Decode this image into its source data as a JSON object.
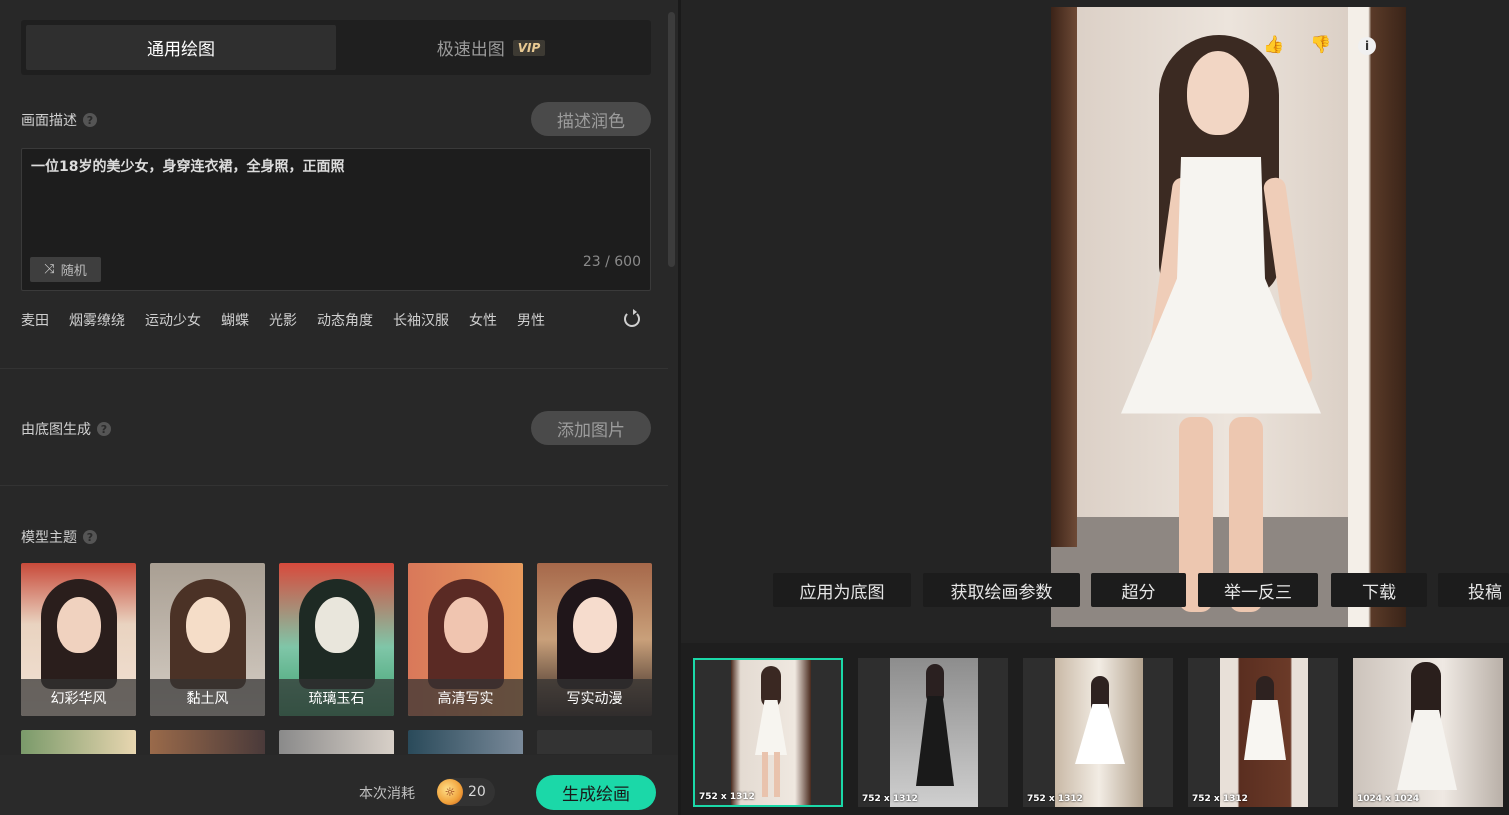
{
  "mode_tabs": [
    {
      "label": "通用绘图",
      "active": true
    },
    {
      "label": "极速出图",
      "active": false,
      "badge": "VIP"
    }
  ],
  "prompt_section": {
    "label": "画面描述",
    "enhance_button": "描述润色",
    "text": "一位18岁的美少女，身穿连衣裙，全身照，正面照",
    "random_button": "随机",
    "char_count": "23 / 600"
  },
  "tags": [
    "麦田",
    "烟雾缭绕",
    "运动少女",
    "蝴蝶",
    "光影",
    "动态角度",
    "长袖汉服",
    "女性",
    "男性"
  ],
  "base_image_section": {
    "label": "由底图生成",
    "add_button": "添加图片"
  },
  "model_section": {
    "label": "模型主题",
    "models": [
      {
        "name": "幻彩华风",
        "selected": false
      },
      {
        "name": "黏土风",
        "selected": false
      },
      {
        "name": "琉璃玉石",
        "selected": false
      },
      {
        "name": "高清写实",
        "selected": true
      },
      {
        "name": "写实动漫",
        "selected": false
      }
    ]
  },
  "footer": {
    "cost_label": "本次消耗",
    "cost_value": "20",
    "generate_button": "生成绘画"
  },
  "actions": [
    "应用为底图",
    "获取绘画参数",
    "超分",
    "举一反三",
    "下载",
    "投稿"
  ],
  "thumbnails": [
    {
      "size": "752 x 1312",
      "selected": true
    },
    {
      "size": "752 x 1312",
      "selected": false
    },
    {
      "size": "752 x 1312",
      "selected": false
    },
    {
      "size": "752 x 1312",
      "selected": false
    },
    {
      "size": "1024 x 1024",
      "selected": false
    }
  ],
  "colors": {
    "accent": "#1bd8a8",
    "vip": "#e8c992",
    "panel_bg": "#282828"
  },
  "icons": {
    "like": "thumbs-up-icon",
    "dislike": "thumbs-down-icon",
    "info": "info-icon",
    "help": "help-icon",
    "shuffle": "shuffle-icon",
    "refresh": "refresh-icon",
    "coin": "coin-icon"
  }
}
